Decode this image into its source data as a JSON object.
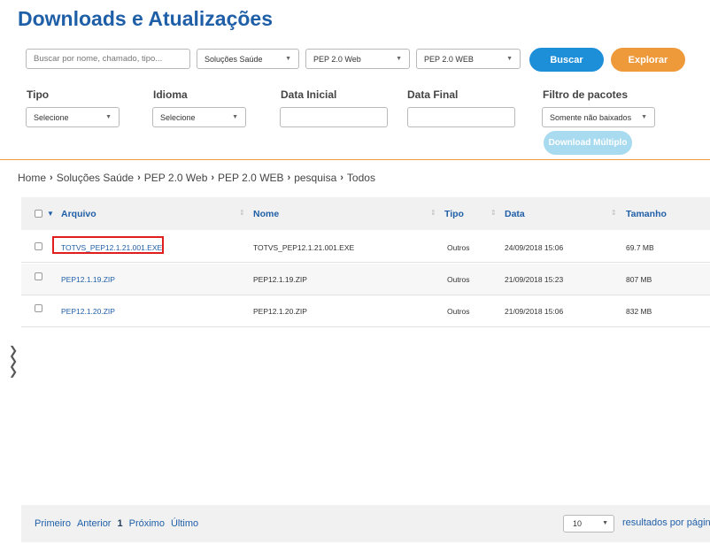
{
  "header": {
    "title": "Downloads e Atualizações"
  },
  "search": {
    "placeholder": "Buscar por nome, chamado, tipo...",
    "selects": [
      "Soluções Saúde",
      "PEP 2.0 Web",
      "PEP 2.0 WEB"
    ],
    "search_button": "Buscar",
    "explore_button": "Explorar"
  },
  "filters": {
    "tipo_label": "Tipo",
    "tipo_value": "Selecione",
    "idioma_label": "Idioma",
    "idioma_value": "Selecione",
    "data_inicial_label": "Data Inicial",
    "data_final_label": "Data Final",
    "pacotes_label": "Filtro de pacotes",
    "pacotes_value": "Somente não baixados",
    "download_multiplo": "Download Múltiplo"
  },
  "breadcrumb": [
    "Home",
    "Soluções Saúde",
    "PEP 2.0 Web",
    "PEP 2.0 WEB",
    "pesquisa",
    "Todos"
  ],
  "table": {
    "columns": [
      "Arquivo",
      "Nome",
      "Tipo",
      "Data",
      "Tamanho"
    ],
    "rows": [
      {
        "arquivo": "TOTVS_PEP12.1.21.001.EXE",
        "nome": "TOTVS_PEP12.1.21.001.EXE",
        "tipo": "Outros",
        "data": "24/09/2018 15:06",
        "tamanho": "69.7 MB"
      },
      {
        "arquivo": "PEP12.1.19.ZIP",
        "nome": "PEP12.1.19.ZIP",
        "tipo": "Outros",
        "data": "21/09/2018 15:23",
        "tamanho": "807 MB"
      },
      {
        "arquivo": "PEP12.1.20.ZIP",
        "nome": "PEP12.1.20.ZIP",
        "tipo": "Outros",
        "data": "21/09/2018 15:06",
        "tamanho": "832 MB"
      }
    ]
  },
  "pagination": {
    "first": "Primeiro",
    "prev": "Anterior",
    "current": "1",
    "next": "Próximo",
    "last": "Último",
    "per_page_value": "10",
    "per_page_label": "resultados por página"
  },
  "colors": {
    "title": "#1f5fa8",
    "accent_blue": "#1d8fd8",
    "accent_orange": "#ee9a3a",
    "highlight_red": "#e01e1e"
  }
}
